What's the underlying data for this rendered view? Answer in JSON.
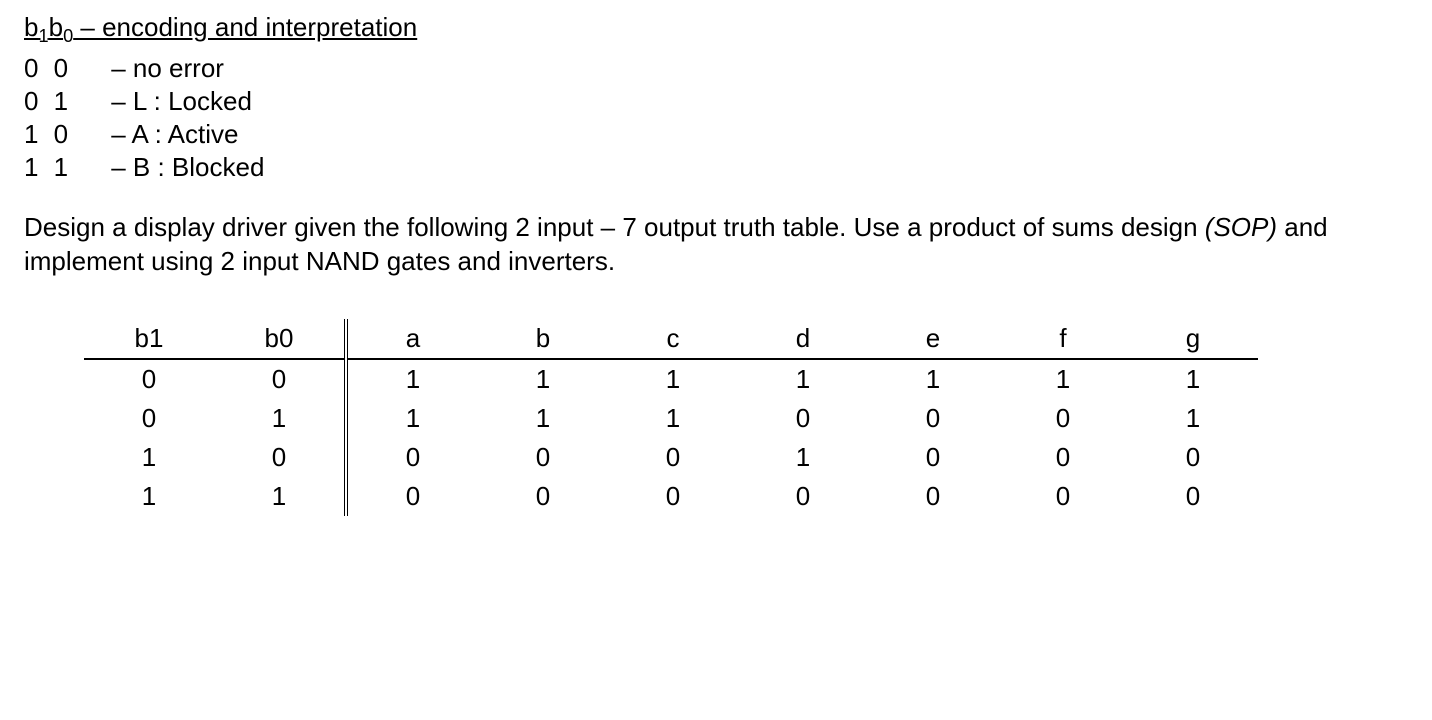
{
  "heading": {
    "b1": "b",
    "b1_sub": "1",
    "b0": "b",
    "b0_sub": "0",
    "rest": "   – encoding and interpretation"
  },
  "encodings": [
    {
      "bits": "0 0",
      "desc": "– no error"
    },
    {
      "bits": "0 1",
      "desc": "– L : Locked"
    },
    {
      "bits": "1 0",
      "desc": "– A : Active"
    },
    {
      "bits": "1 1",
      "desc": "– B : Blocked"
    }
  ],
  "paragraph": {
    "p1": "Design a display driver given the following 2 input – 7 output truth table. Use a product of sums design ",
    "sop": "(SOP)",
    "p2": " and implement using 2 input NAND gates and inverters."
  },
  "table": {
    "headers": [
      "b1",
      "b0",
      "a",
      "b",
      "c",
      "d",
      "e",
      "f",
      "g"
    ],
    "rows": [
      [
        "0",
        "0",
        "1",
        "1",
        "1",
        "1",
        "1",
        "1",
        "1"
      ],
      [
        "0",
        "1",
        "1",
        "1",
        "1",
        "0",
        "0",
        "0",
        "1"
      ],
      [
        "1",
        "0",
        "0",
        "0",
        "0",
        "1",
        "0",
        "0",
        "0"
      ],
      [
        "1",
        "1",
        "0",
        "0",
        "0",
        "0",
        "0",
        "0",
        "0"
      ]
    ]
  },
  "chart_data": {
    "type": "table",
    "columns": [
      "b1",
      "b0",
      "a",
      "b",
      "c",
      "d",
      "e",
      "f",
      "g"
    ],
    "rows": [
      [
        0,
        0,
        1,
        1,
        1,
        1,
        1,
        1,
        1
      ],
      [
        0,
        1,
        1,
        1,
        1,
        0,
        0,
        0,
        1
      ],
      [
        1,
        0,
        0,
        0,
        0,
        1,
        0,
        0,
        0
      ],
      [
        1,
        1,
        0,
        0,
        0,
        0,
        0,
        0,
        0
      ]
    ],
    "title": "2-input 7-output truth table for display driver"
  }
}
